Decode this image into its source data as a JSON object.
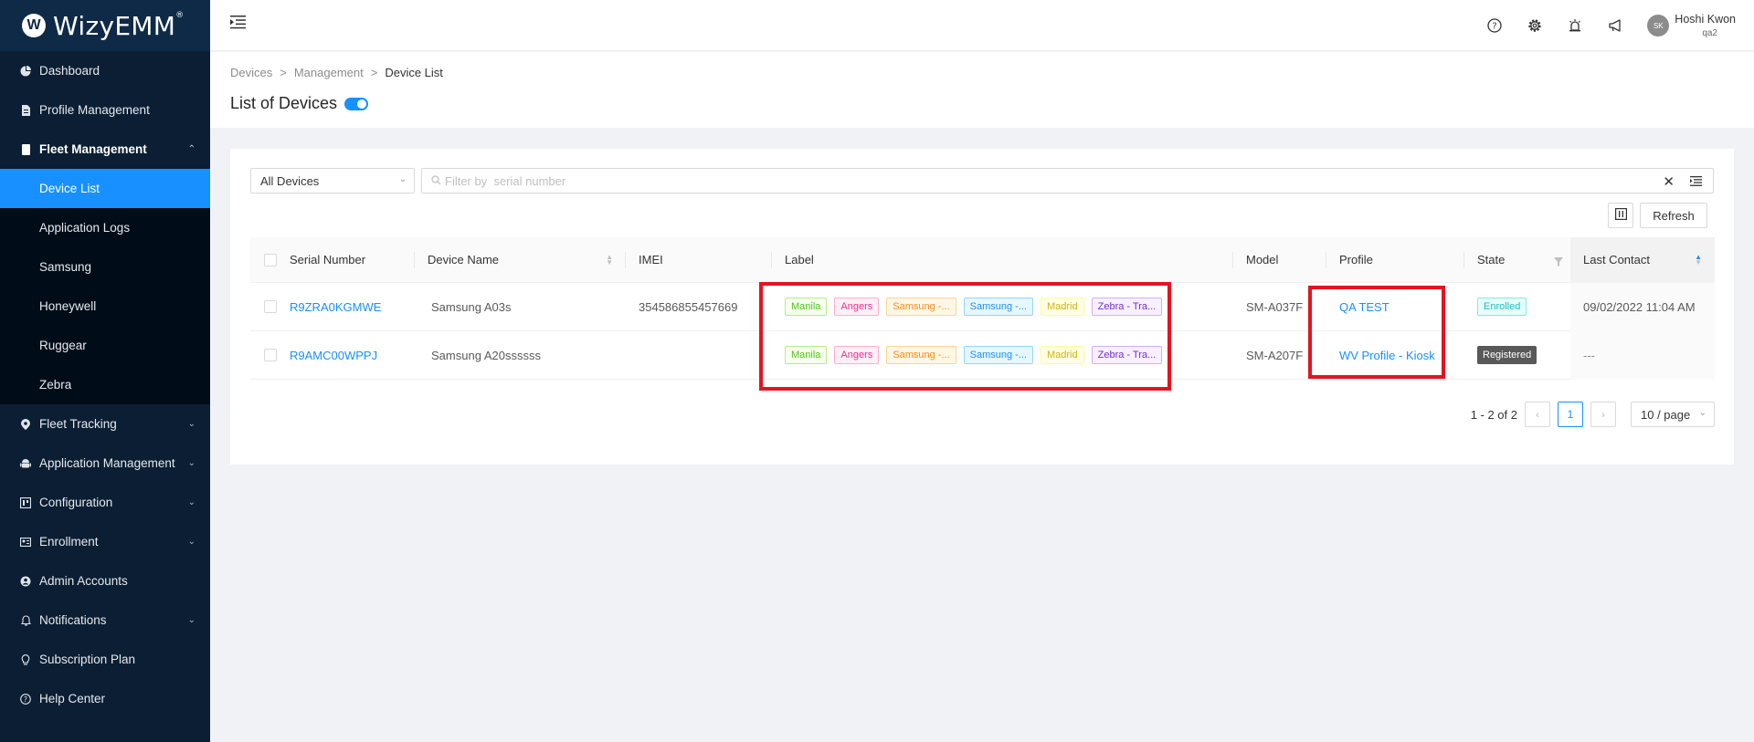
{
  "app": {
    "logo_letter": "W",
    "name": "WizyEMM",
    "trademark": "®"
  },
  "sidebar": {
    "items": [
      {
        "label": "Dashboard",
        "icon": "pie-chart-icon"
      },
      {
        "label": "Profile Management",
        "icon": "document-icon"
      },
      {
        "label": "Fleet Management",
        "icon": "device-icon",
        "expanded": true
      },
      {
        "label": "Fleet Tracking",
        "icon": "location-pin-icon"
      },
      {
        "label": "Application Management",
        "icon": "android-icon"
      },
      {
        "label": "Configuration",
        "icon": "config-icon"
      },
      {
        "label": "Enrollment",
        "icon": "enrollment-icon"
      },
      {
        "label": "Admin Accounts",
        "icon": "admin-icon"
      },
      {
        "label": "Notifications",
        "icon": "bell-icon"
      },
      {
        "label": "Subscription Plan",
        "icon": "bulb-icon"
      },
      {
        "label": "Help Center",
        "icon": "help-icon"
      }
    ],
    "fleet_sub": [
      "Device List",
      "Application Logs",
      "Samsung",
      "Honeywell",
      "Ruggear",
      "Zebra"
    ],
    "active_sub": "Device List"
  },
  "topbar": {
    "user_initials": "SK",
    "user_name": "Hoshi Kwon",
    "user_sub": "qa2"
  },
  "breadcrumb": [
    "Devices",
    "Management",
    "Device List"
  ],
  "page_title": "List of Devices",
  "filters": {
    "select_value": "All Devices",
    "search_placeholder": "Filter by  serial number",
    "refresh_label": "Refresh"
  },
  "table": {
    "columns": [
      "Serial Number",
      "Device Name",
      "IMEI",
      "Label",
      "Model",
      "Profile",
      "State",
      "Last Contact"
    ],
    "rows": [
      {
        "serial": "R9ZRA0KGMWE",
        "device_name": "Samsung A03s",
        "imei": "354586855457669",
        "labels": [
          "Manila",
          "Angers",
          "Samsung -...",
          "Samsung -...",
          "Madrid",
          "Zebra - Tra..."
        ],
        "model": "SM-A037F",
        "profile": "QA TEST",
        "state": "Enrolled",
        "last_contact": "09/02/2022 11:04 AM"
      },
      {
        "serial": "R9AMC00WPPJ",
        "device_name": "Samsung A20ssssss",
        "imei": "",
        "labels": [
          "Manila",
          "Angers",
          "Samsung -...",
          "Samsung -...",
          "Madrid",
          "Zebra - Tra..."
        ],
        "model": "SM-A207F",
        "profile": "WV Profile - Kiosk",
        "state": "Registered",
        "last_contact": "---"
      }
    ]
  },
  "tag_colors": [
    {
      "text": "#52c41a",
      "border": "#b7eb8f",
      "bg": "#f6ffed"
    },
    {
      "text": "#eb2f96",
      "border": "#ffadd2",
      "bg": "#fff0f6"
    },
    {
      "text": "#fa8c16",
      "border": "#ffd591",
      "bg": "#fff7e6"
    },
    {
      "text": "#1890ff",
      "border": "#91d5ff",
      "bg": "#e6f7ff"
    },
    {
      "text": "#d4b106",
      "border": "#fffb8f",
      "bg": "#feffe6"
    },
    {
      "text": "#722ed1",
      "border": "#d3adf7",
      "bg": "#f9f0ff"
    }
  ],
  "pagination": {
    "total": "1 - 2 of 2",
    "current": "1",
    "page_size": "10 / page"
  },
  "colors": {
    "accent": "#1890ff",
    "highlight": "#e4141f",
    "sidebar_bg": "#0b1e33"
  }
}
